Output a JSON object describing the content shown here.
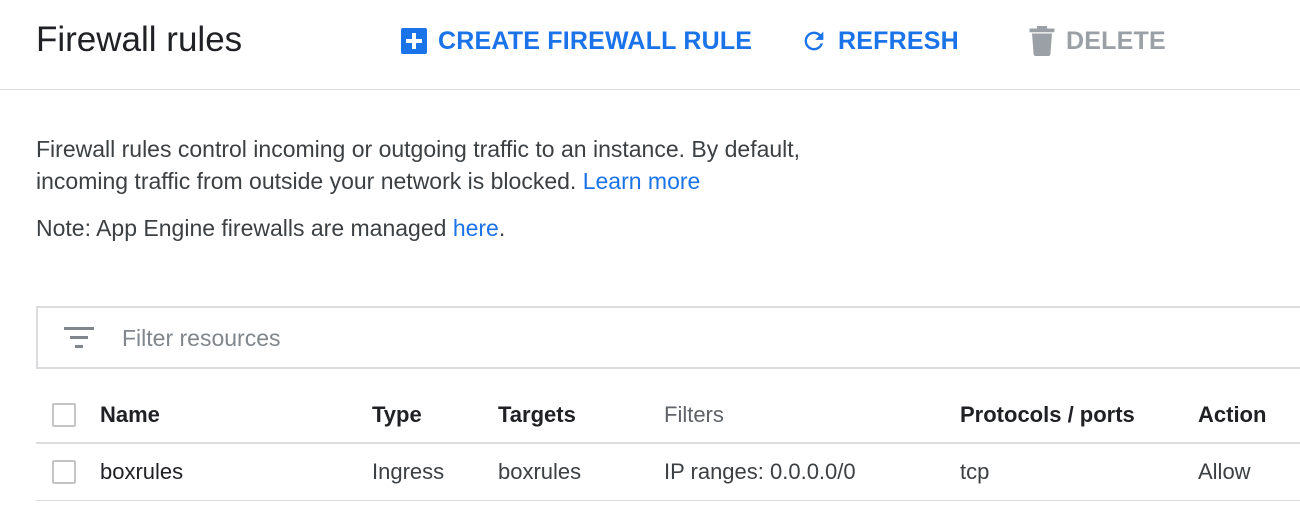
{
  "header": {
    "title": "Firewall rules",
    "create_label": "CREATE FIREWALL RULE",
    "refresh_label": "REFRESH",
    "delete_label": "DELETE"
  },
  "description": {
    "text": "Firewall rules control incoming or outgoing traffic to an instance. By default, incoming traffic from outside your network is blocked.",
    "learn_more": "Learn more",
    "note_prefix": "Note: App Engine firewalls are managed",
    "note_link": "here",
    "note_suffix": "."
  },
  "filter": {
    "placeholder": "Filter resources"
  },
  "table": {
    "columns": {
      "name": "Name",
      "type": "Type",
      "targets": "Targets",
      "filters": "Filters",
      "protocols": "Protocols / ports",
      "action": "Action"
    },
    "rows": [
      {
        "name": "boxrules",
        "type": "Ingress",
        "targets": "boxrules",
        "filters": "IP ranges: 0.0.0.0/0",
        "protocols": "tcp",
        "action": "Allow"
      }
    ]
  },
  "icons": {
    "create": "add-box-icon",
    "refresh": "refresh-icon",
    "delete": "trash-icon",
    "filter": "filter-list-icon"
  },
  "colors": {
    "accent": "#1a73e8",
    "disabled": "#9aa0a6",
    "divider": "#dadce0"
  }
}
